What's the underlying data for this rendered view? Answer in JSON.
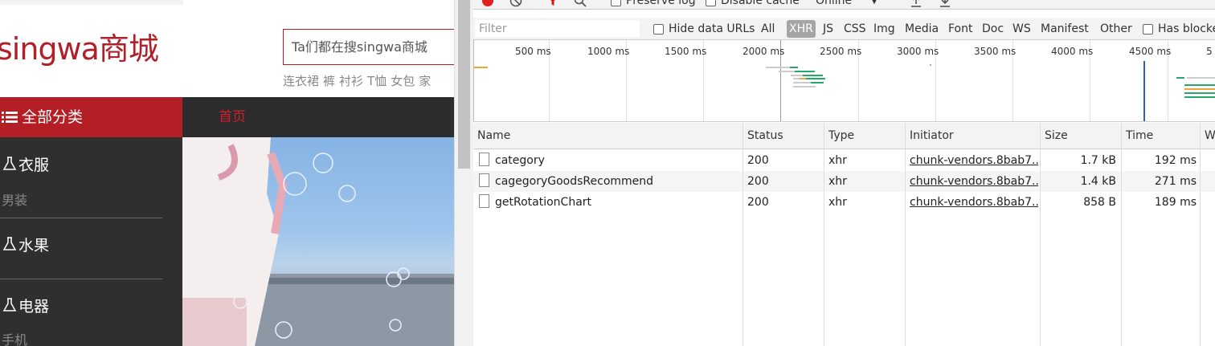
{
  "shop": {
    "logo": "singwa商城",
    "search_placeholder": "Ta们都在搜singwa商城",
    "hot_words": [
      "连衣裙",
      "裤",
      "衬衫",
      "T恤",
      "女包",
      "家"
    ],
    "all_categories": "全部分类",
    "nav_home": "首页",
    "categories": [
      {
        "name": "衣服",
        "sub": "男装"
      },
      {
        "name": "水果",
        "sub": ""
      },
      {
        "name": "电器",
        "sub": "手机"
      }
    ]
  },
  "devtools": {
    "toolbar": {
      "preserve_log": "Preserve log",
      "disable_cache": "Disable cache",
      "throttle": "Online"
    },
    "filter": {
      "placeholder": "Filter",
      "hide_data_urls": "Hide data URLs",
      "types": [
        "All",
        "XHR",
        "JS",
        "CSS",
        "Img",
        "Media",
        "Font",
        "Doc",
        "WS",
        "Manifest",
        "Other"
      ],
      "active_type": "XHR",
      "has_blocked": "Has blocke"
    },
    "overview_ticks": [
      "500 ms",
      "1000 ms",
      "1500 ms",
      "2000 ms",
      "2500 ms",
      "3000 ms",
      "3500 ms",
      "4000 ms",
      "4500 ms",
      "5"
    ],
    "columns": [
      "Name",
      "Status",
      "Type",
      "Initiator",
      "Size",
      "Time",
      "W"
    ],
    "requests": [
      {
        "name": "category",
        "status": "200",
        "type": "xhr",
        "initiator": "chunk-vendors.8bab7...",
        "size": "1.7 kB",
        "time": "192 ms"
      },
      {
        "name": "cagegoryGoodsRecommend",
        "status": "200",
        "type": "xhr",
        "initiator": "chunk-vendors.8bab7...",
        "size": "1.4 kB",
        "time": "271 ms"
      },
      {
        "name": "getRotationChart",
        "status": "200",
        "type": "xhr",
        "initiator": "chunk-vendors.8bab7...",
        "size": "858 B",
        "time": "189 ms"
      }
    ],
    "colors": {
      "record": "#e0201f",
      "filter_icon": "#d11a1a",
      "active_type_bg": "#a5a5a5",
      "brand_red": "#b41f25"
    }
  }
}
